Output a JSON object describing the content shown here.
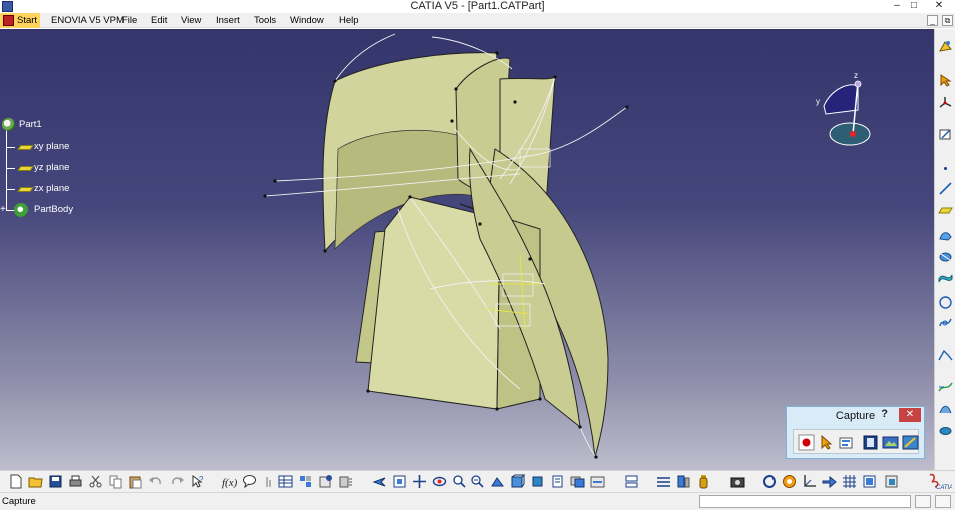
{
  "window": {
    "title": "CATIA V5 - [Part1.CATPart]",
    "controls": {
      "minimize": "–",
      "maximize": "□",
      "close": "✕"
    }
  },
  "menu": {
    "items": [
      "Start",
      "ENOVIA V5 VPM",
      "File",
      "Edit",
      "View",
      "Insert",
      "Tools",
      "Window",
      "Help"
    ],
    "doc_controls": {
      "minimize": "_",
      "restore": "⧉"
    }
  },
  "spec_tree": {
    "root": "Part1",
    "children": [
      "xy plane",
      "yz plane",
      "zx plane",
      "PartBody"
    ]
  },
  "compass": {
    "axis_x": "x",
    "axis_y": "y",
    "axis_z": "z"
  },
  "capture_toolbar": {
    "title": "Capture",
    "help": "?",
    "close": "✕"
  },
  "statusbar": {
    "message": "Capture",
    "command_input": ""
  },
  "colors": {
    "surface": "#d6d9a4",
    "surface_shade": "#a9ac6c",
    "viewport_top": "#34356b",
    "viewport_bottom": "#bdbdcd",
    "start_menu": "#ffd35c",
    "capture_panel": "#d9ebf7"
  },
  "icons": {
    "right_toolbar": [
      "sketcher-icon",
      "select-icon",
      "axis-system-icon",
      "sketch-icon",
      "point-icon",
      "line-icon",
      "plane-icon",
      "extrude-surface-icon",
      "revolve-surface-icon",
      "sweep-icon",
      "circle-icon",
      "spline-icon",
      "corner-icon",
      "connect-curve-icon",
      "project-icon",
      "intersect-icon"
    ],
    "bottom_toolbar": [
      "new-icon",
      "open-icon",
      "save-icon",
      "print-icon",
      "cut-icon",
      "copy-icon",
      "paste-icon",
      "undo-icon",
      "redo-icon",
      "whats-this-icon",
      "formula-icon",
      "knowledge-icon",
      "measure-icon",
      "table-icon",
      "catalog-icon",
      "parameters-icon",
      "hole-icon",
      "fly-mode-icon",
      "fit-all-icon",
      "pan-icon",
      "rotate-icon",
      "zoom-in-icon",
      "zoom-out-icon",
      "normal-view-icon",
      "iso-view-icon",
      "views-icon",
      "render-style-icon",
      "hide-show-icon",
      "swap-space-icon",
      "select-icon",
      "spec-tree-icon",
      "cut-surface-icon",
      "split-icon",
      "bottle-icon",
      "capture-icon",
      "update-icon",
      "analysis-icon",
      "axis-icon",
      "grid-icon",
      "snap-icon",
      "repeat-icon",
      "catia-logo-icon"
    ],
    "capture": [
      "record-icon",
      "select-mode-icon",
      "options-icon",
      "album-icon",
      "capture-image-icon",
      "settings-icon"
    ]
  }
}
